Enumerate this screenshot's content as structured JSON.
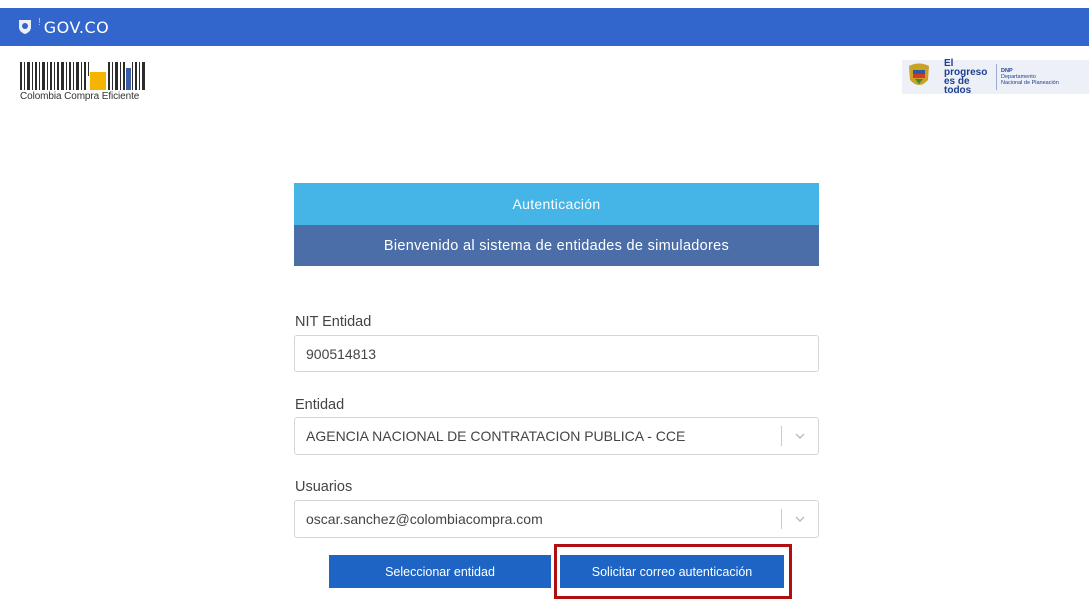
{
  "govbar": {
    "brand": "GOV.CO",
    "icon": "colombia-shield-icon",
    "color": "#3366cc"
  },
  "logos": {
    "left_caption": "Colombia Compra Eficiente",
    "right_slogan_line1": "El progreso",
    "right_slogan_line2": "es de todos",
    "right_org_line1": "DNP",
    "right_org_line2": "Departamento",
    "right_org_line3": "Nacional de Planeación"
  },
  "panel": {
    "title": "Autenticación",
    "subtitle": "Bienvenido al sistema de entidades de simuladores",
    "title_color": "#45b4e6",
    "subtitle_color": "#4b6ea8"
  },
  "form": {
    "nit_label": "NIT Entidad",
    "nit_value": "900514813",
    "entidad_label": "Entidad",
    "entidad_value": "AGENCIA NACIONAL DE CONTRATACION PUBLICA - CCE",
    "usuarios_label": "Usuarios",
    "usuarios_value": "oscar.sanchez@colombiacompra.com"
  },
  "actions": {
    "select_entity": "Seleccionar entidad",
    "request_email": "Solicitar correo autenticación",
    "button_color": "#1d64c4",
    "highlight_color": "#b00e10"
  }
}
